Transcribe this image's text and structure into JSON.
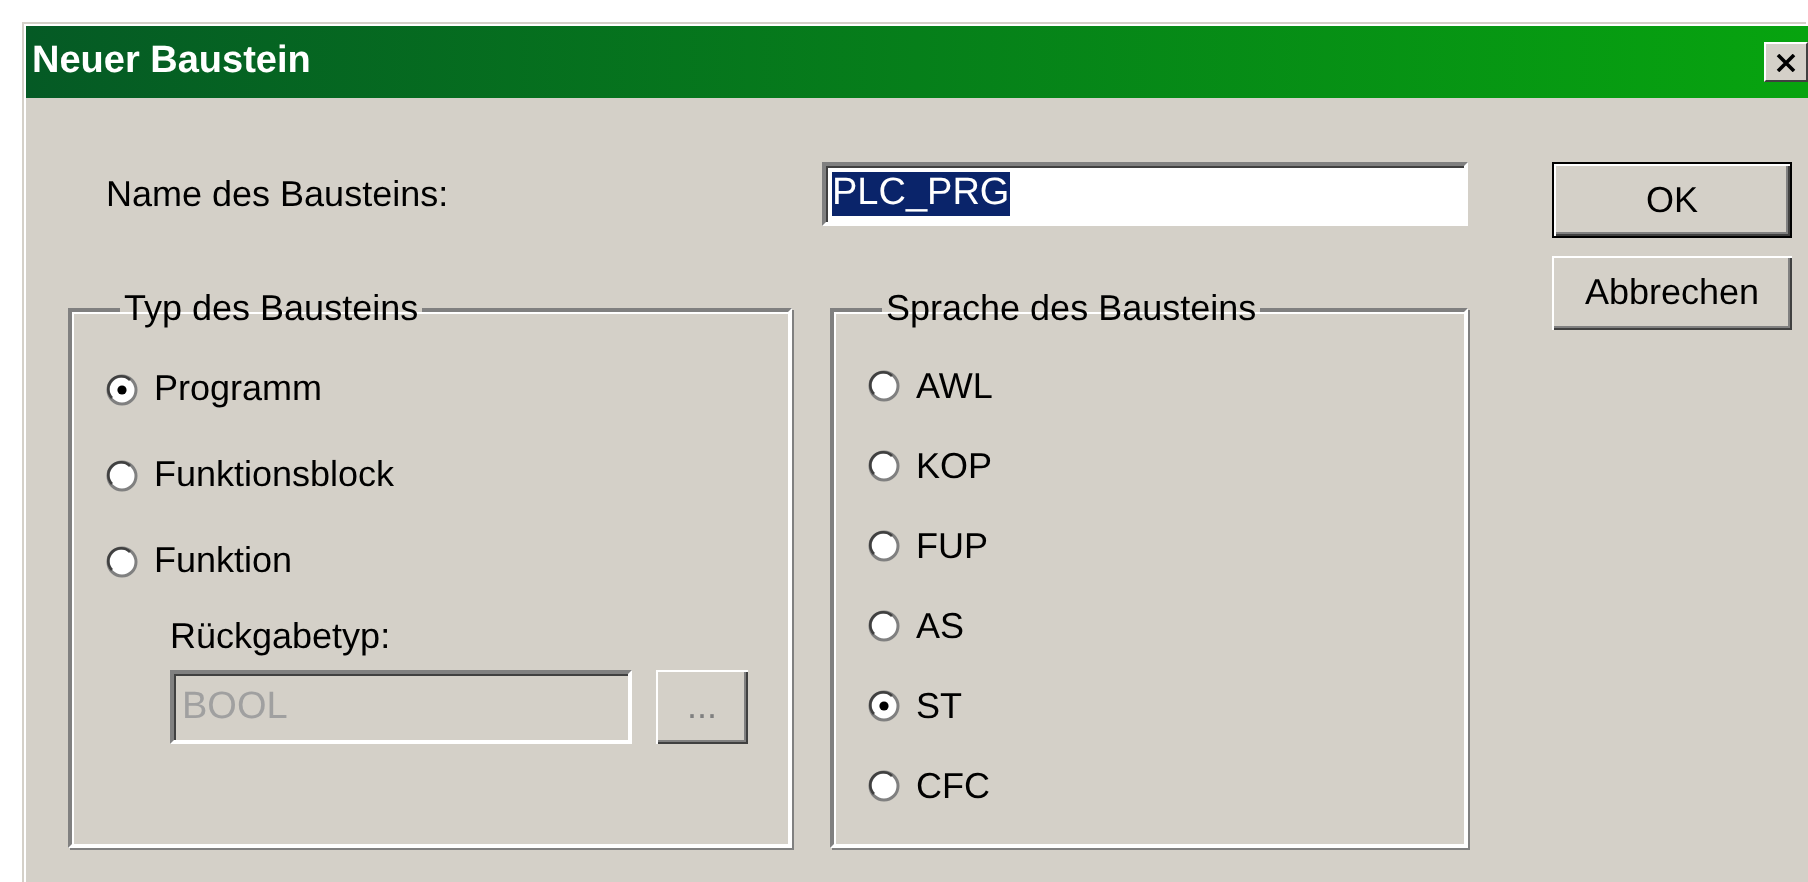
{
  "window": {
    "title": "Neuer Baustein"
  },
  "name_field": {
    "label": "Name des Bausteins:",
    "value": "PLC_PRG",
    "text_selected": true
  },
  "type_group": {
    "title": "Typ des Bausteins",
    "options": [
      {
        "label": "Programm",
        "selected": true
      },
      {
        "label": "Funktionsblock",
        "selected": false
      },
      {
        "label": "Funktion",
        "selected": false
      }
    ]
  },
  "return_type": {
    "label": "Rückgabetyp:",
    "value": "BOOL",
    "browse": "...",
    "disabled": true
  },
  "language_group": {
    "title": "Sprache des Bausteins",
    "options": [
      {
        "label": "AWL",
        "selected": false
      },
      {
        "label": "KOP",
        "selected": false
      },
      {
        "label": "FUP",
        "selected": false
      },
      {
        "label": "AS",
        "selected": false
      },
      {
        "label": "ST",
        "selected": true
      },
      {
        "label": "CFC",
        "selected": false
      }
    ]
  },
  "buttons": [
    {
      "label": "OK",
      "default": true
    },
    {
      "label": "Abbrechen",
      "default": false
    }
  ]
}
